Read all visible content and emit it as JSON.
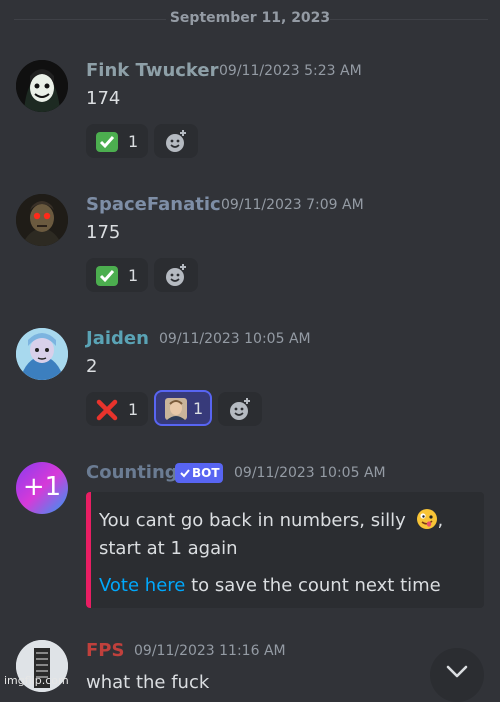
{
  "date_divider": "September 11, 2023",
  "messages": [
    {
      "author": "Fink Twucker",
      "author_color": "#8ea0a8",
      "timestamp": "09/11/2023 5:23 AM",
      "content": "174",
      "reactions": [
        {
          "emoji": "check-mark-emoji",
          "count": "1"
        }
      ]
    },
    {
      "author": "SpaceFanatic",
      "author_color": "#7e8ea6",
      "timestamp": "09/11/2023 7:09 AM",
      "content": "175",
      "reactions": [
        {
          "emoji": "check-mark-emoji",
          "count": "1"
        }
      ]
    },
    {
      "author": "Jaiden",
      "author_color": "#5aa3b5",
      "timestamp": "09/11/2023 10:05 AM",
      "content": "2",
      "reactions": [
        {
          "emoji": "cross-mark-emoji",
          "count": "1"
        },
        {
          "emoji": "custom-face-emoji",
          "count": "1"
        }
      ]
    },
    {
      "author": "Counting",
      "author_color": "#6b7c93",
      "bot_tag": "BOT",
      "timestamp": "09/11/2023 10:05 AM",
      "avatar_text": "+1",
      "embed": {
        "line1": "You cant go back in numbers, silly",
        "line2": "start at 1 again",
        "link_text": "Vote here",
        "after_link": "to save the count next time",
        "bar_color": "#e91e63"
      }
    },
    {
      "author": "FPS",
      "author_color": "#c0403c",
      "timestamp": "09/11/2023 11:16 AM",
      "content": "what the fuck"
    }
  ],
  "watermark": "imgflip.com"
}
